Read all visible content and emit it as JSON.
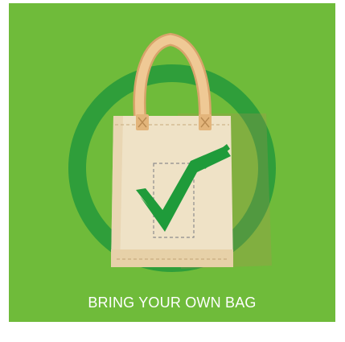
{
  "poster": {
    "caption": "BRING YOUR OWN BAG",
    "icons": [
      "green-circle-ring-icon",
      "tote-bag-icon",
      "checkmark-icon"
    ],
    "colors": {
      "background": "#6fbb3a",
      "ring": "#2f9e3a",
      "bag": "#efe2c6",
      "bag_shadow": "#e2c89d",
      "handle": "#e9c08a",
      "checkmark": "#1f9b3a",
      "caption": "#ffffff"
    }
  }
}
